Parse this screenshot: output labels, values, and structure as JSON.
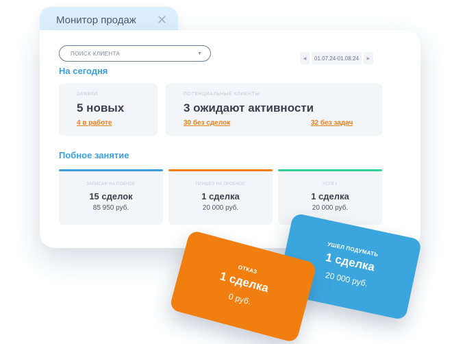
{
  "window": {
    "tab_title": "Монитор продаж",
    "close_glyph": "✕",
    "close_icon": "close-icon"
  },
  "search": {
    "placeholder": "ПОИСК КЛИЕНТА",
    "arrow_glyph": "▼",
    "arrow_icon": "chevron-down-icon"
  },
  "date_range": {
    "prev_glyph": "◀",
    "text": "01.07.24-01.08.24",
    "next_glyph": "▶"
  },
  "today": {
    "title": "На сегодня",
    "requests": {
      "label": "ЗАЯВКИ",
      "value": "5 новых",
      "link": "4 в работе"
    },
    "potential": {
      "label": "ПОТЕНЦИАЛЬНЫЕ КЛИЕНТЫ",
      "value": "3 ожидают активности",
      "link_left": "30 без сделок",
      "link_right": "32 без задач"
    }
  },
  "trial": {
    "title": "Побное  занятие",
    "stages": [
      {
        "label": "ЗАПИСАН НА ПОБНОЕ",
        "count": "15 сделок",
        "sum": "85 950 руб.",
        "color": "#3a9fdc"
      },
      {
        "label": "ПРИШЕЛ НА ПРОБНОЕ",
        "count": "1 сделка",
        "sum": "20 000 руб.",
        "color": "#f07e14"
      },
      {
        "label": "УСПЕХ",
        "count": "1 сделка",
        "sum": "20 000 руб.",
        "color": "#34cf96"
      }
    ]
  },
  "floating": {
    "thinking": {
      "label": "УШЕЛ ПОДУМАТЬ",
      "count": "1 сделка",
      "sum": "20 000 руб.",
      "color": "#3ba6dd"
    },
    "refusal": {
      "label": "ОТКАЗ",
      "count": "1 сделка",
      "sum": "0 руб.",
      "color": "#f07f0f"
    }
  }
}
